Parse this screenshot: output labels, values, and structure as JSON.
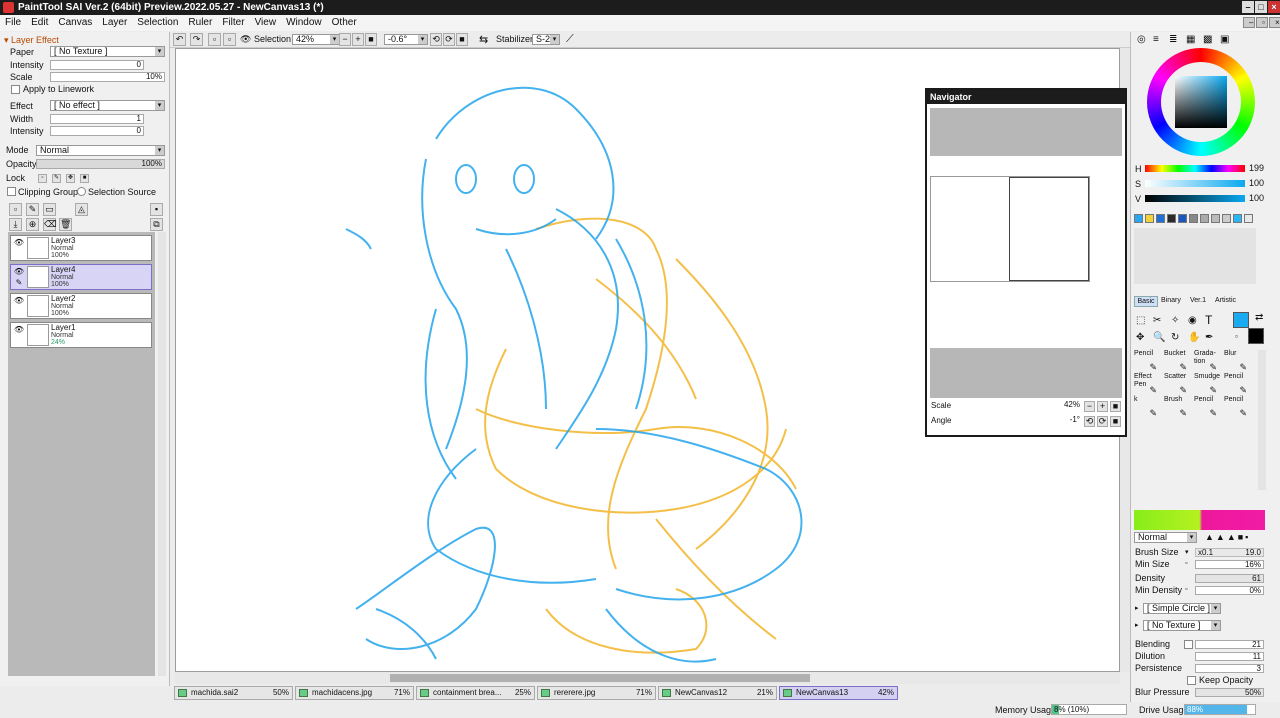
{
  "window": {
    "title": "PaintTool SAI Ver.2 (64bit) Preview.2022.05.27 - NewCanvas13 (*)"
  },
  "menu": [
    "File",
    "Edit",
    "Canvas",
    "Layer",
    "Selection",
    "Ruler",
    "Filter",
    "View",
    "Window",
    "Other"
  ],
  "layer_effect": {
    "header": "Layer Effect",
    "paper_label": "Paper",
    "paper_value": "[ No Texture ]",
    "intensity_label": "Intensity",
    "intensity_value": "0",
    "scale_label": "Scale",
    "scale_value": "10%",
    "apply_linework": "Apply to Linework",
    "effect_label": "Effect",
    "effect_value": "[ No effect ]",
    "width_label": "Width",
    "width_value": "1",
    "intensity2_label": "Intensity",
    "intensity2_value": "0",
    "mode_label": "Mode",
    "mode_value": "Normal",
    "opacity_label": "Opacity",
    "opacity_value": "100%",
    "lock_label": "Lock",
    "clipping_group": "Clipping Group",
    "selection_source": "Selection Source"
  },
  "layers": [
    {
      "name": "Layer3",
      "mode": "Normal",
      "opacity": "100%",
      "selected": false
    },
    {
      "name": "Layer4",
      "mode": "Normal",
      "opacity": "100%",
      "selected": true
    },
    {
      "name": "Layer2",
      "mode": "Normal",
      "opacity": "100%",
      "selected": false
    },
    {
      "name": "Layer1",
      "mode": "Normal",
      "opacity": "24%",
      "selected": false
    }
  ],
  "toolbar": {
    "selection_label": "Selection",
    "zoom_value": "42%",
    "rotation_value": "-0.6°",
    "stabilizer_label": "Stabilizer",
    "stabilizer_value": "S-2"
  },
  "navigator": {
    "title": "Navigator",
    "scale_label": "Scale",
    "scale_value": "42%",
    "angle_label": "Angle",
    "angle_value": "-1°"
  },
  "color": {
    "h_label": "H",
    "h_value": "199",
    "s_label": "S",
    "s_value": "100",
    "v_label": "V",
    "v_value": "100",
    "current": "#1aaaf0",
    "swatches": [
      "#2aa6f0",
      "#f4d23a",
      "#1f6fd6",
      "#2a2a2a",
      "#1a55c0",
      "#888888",
      "#aaaaaa",
      "#bbbbbb",
      "#cccccc",
      "#29b6f6",
      "#e8e8e8"
    ]
  },
  "tool_tabs": [
    "Basic",
    "Binary",
    "Ver.1",
    "Artistic"
  ],
  "brushes": [
    {
      "name": "Pencil",
      "icon": "pencil-icon"
    },
    {
      "name": "Bucket",
      "icon": "bucket-icon"
    },
    {
      "name": "Grada-tion",
      "icon": "gradation-icon"
    },
    {
      "name": "Blur",
      "icon": "blur-icon"
    },
    {
      "name": "Effect Pen",
      "icon": "effect-pen-icon"
    },
    {
      "name": "Scatter",
      "icon": "scatter-icon"
    },
    {
      "name": "Smudge",
      "icon": "smudge-icon"
    },
    {
      "name": "Pencil",
      "icon": "pencil-icon"
    },
    {
      "name": "k",
      "icon": "pencil-icon"
    },
    {
      "name": "Brush",
      "icon": "brush-icon"
    },
    {
      "name": "Pencil",
      "icon": "pencil-icon"
    },
    {
      "name": "Pencil",
      "icon": "pencil-icon"
    }
  ],
  "brush_settings": {
    "mode_value": "Normal",
    "brush_size_label": "Brush Size",
    "brush_size_mult": "x0.1",
    "brush_size_value": "19.0",
    "min_size_label": "Min Size",
    "min_size_value": "16%",
    "density_label": "Density",
    "density_value": "61",
    "min_density_label": "Min Density",
    "min_density_value": "0%",
    "shape_value": "[ Simple Circle ]",
    "texture_value": "[ No Texture ]",
    "blending_label": "Blending",
    "blending_value": "21",
    "dilution_label": "Dilution",
    "dilution_value": "11",
    "persistence_label": "Persistence",
    "persistence_value": "3",
    "keep_opacity": "Keep Opacity",
    "blur_pressure_label": "Blur Pressure",
    "blur_pressure_value": "50%"
  },
  "doc_tabs": [
    {
      "name": "machida.sai2",
      "zoom": "50%",
      "active": false
    },
    {
      "name": "machidacens.jpg",
      "zoom": "71%",
      "active": false
    },
    {
      "name": "containment brea...",
      "zoom": "25%",
      "active": false
    },
    {
      "name": "rererere.jpg",
      "zoom": "71%",
      "active": false
    },
    {
      "name": "NewCanvas12",
      "zoom": "21%",
      "active": false
    },
    {
      "name": "NewCanvas13",
      "zoom": "42%",
      "active": true
    }
  ],
  "status": {
    "memory_label": "Memory Usage",
    "memory_value": "8% (10%)",
    "memory_level": 0.09,
    "drive_label": "Drive Usage",
    "drive_value": "88%",
    "drive_level": 0.88
  }
}
